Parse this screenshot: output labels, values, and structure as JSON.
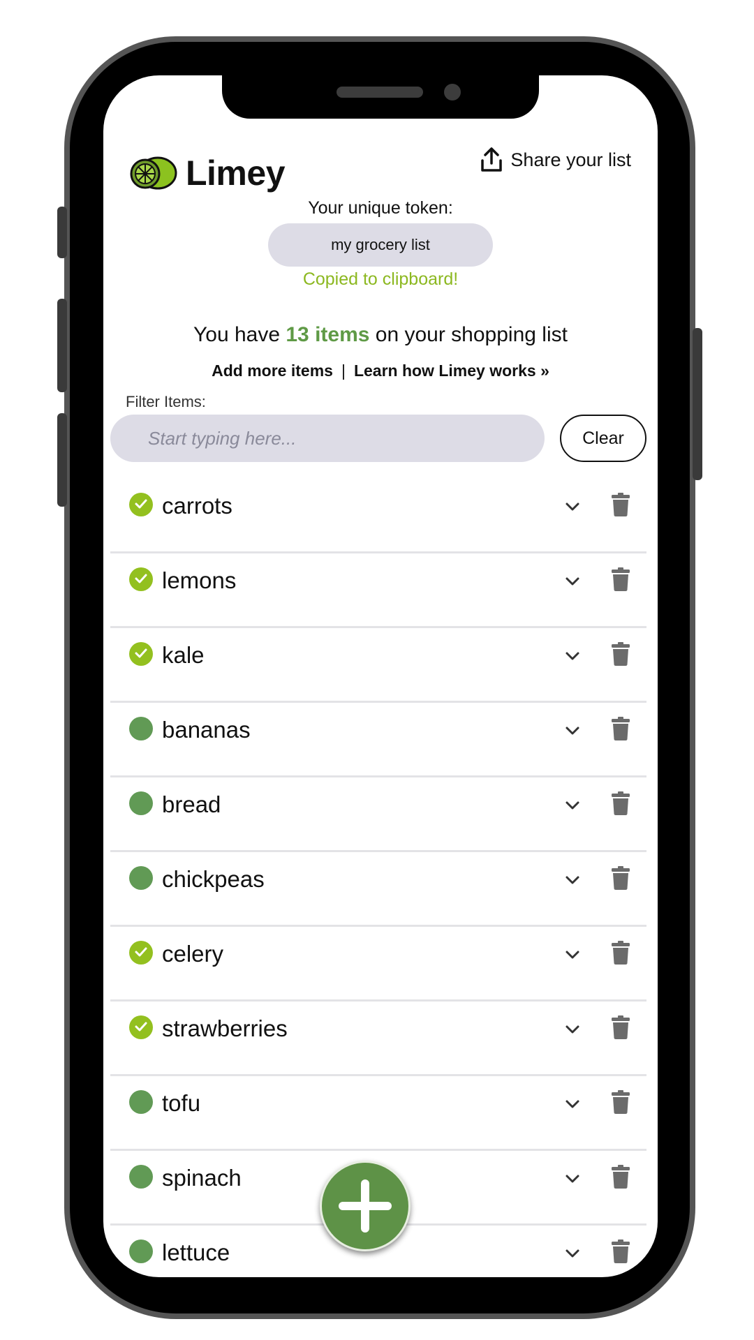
{
  "app": {
    "name": "Limey"
  },
  "header": {
    "share_label": "Share your list"
  },
  "token": {
    "label": "Your unique token:",
    "value": "my grocery list",
    "copied_message": "Copied to clipboard!"
  },
  "summary": {
    "prefix": "You have ",
    "count_text": "13 items",
    "suffix": " on your shopping list"
  },
  "links": {
    "add_more": "Add more items",
    "separator": "|",
    "learn": "Learn how Limey works »"
  },
  "filter": {
    "label": "Filter Items:",
    "placeholder": "Start typing here...",
    "value": "",
    "clear_label": "Clear"
  },
  "items": [
    {
      "label": "carrots",
      "checked": true
    },
    {
      "label": "lemons",
      "checked": true
    },
    {
      "label": "kale",
      "checked": true
    },
    {
      "label": "bananas",
      "checked": false
    },
    {
      "label": "bread",
      "checked": false
    },
    {
      "label": "chickpeas",
      "checked": false
    },
    {
      "label": "celery",
      "checked": true
    },
    {
      "label": "strawberries",
      "checked": true
    },
    {
      "label": "tofu",
      "checked": false
    },
    {
      "label": "spinach",
      "checked": false
    },
    {
      "label": "lettuce",
      "checked": false
    }
  ],
  "icons": {
    "logo": "lime-logo-icon",
    "share": "share-upload-icon",
    "check": "check-icon",
    "expand": "chevron-down-icon",
    "delete": "trash-icon",
    "add": "plus-icon"
  },
  "colors": {
    "accent_green": "#5f9a46",
    "checked_green": "#93c01f",
    "copied_text": "#8cb820",
    "pill_background": "#dddce6"
  }
}
